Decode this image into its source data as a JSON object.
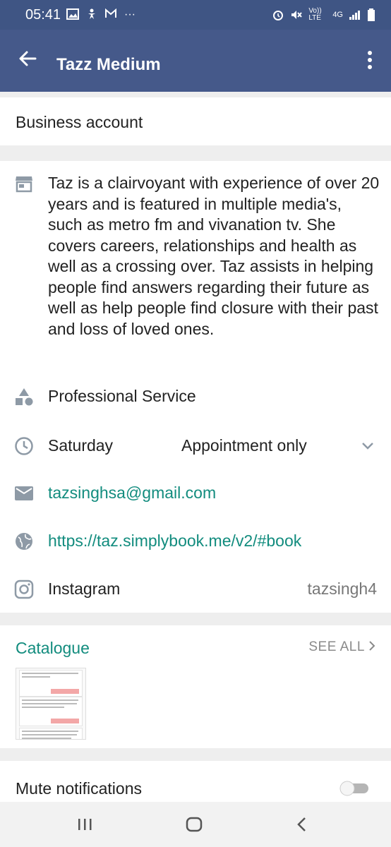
{
  "status_bar": {
    "time": "05:41",
    "left_icons": [
      "image-icon",
      "accessibility-icon",
      "gmail-icon",
      "more-dots"
    ],
    "right_icons": [
      "alarm-icon",
      "mute-icon",
      "volte-icon",
      "4g-icon",
      "signal-icon",
      "battery-icon"
    ],
    "volte_text": "Vo)) LTE",
    "network_text": "4G"
  },
  "app_bar": {
    "title": "Tazz Medium",
    "background": "#45598a"
  },
  "business_label": "Business account",
  "description": "Taz is a clairvoyant with experience of over 20 years and is featured in multiple media's, such as metro fm and vivanation tv. She covers careers, relationships and health as well as a crossing over. Taz assists in helping people find answers regarding their future as well as help people find closure with their past and loss of loved ones.",
  "category": "Professional Service",
  "hours": {
    "day": "Saturday",
    "value": "Appointment only"
  },
  "email": "tazsinghsa@gmail.com",
  "website": "https://taz.simplybook.me/v2/#book",
  "instagram": {
    "label": "Instagram",
    "handle": "tazsingh4"
  },
  "catalogue": {
    "title": "Catalogue",
    "see_all": "SEE ALL"
  },
  "mute_notifications": {
    "label": "Mute notifications",
    "enabled": false
  },
  "colors": {
    "accent": "#128c7e",
    "icon_gray": "#8e9aa6"
  }
}
